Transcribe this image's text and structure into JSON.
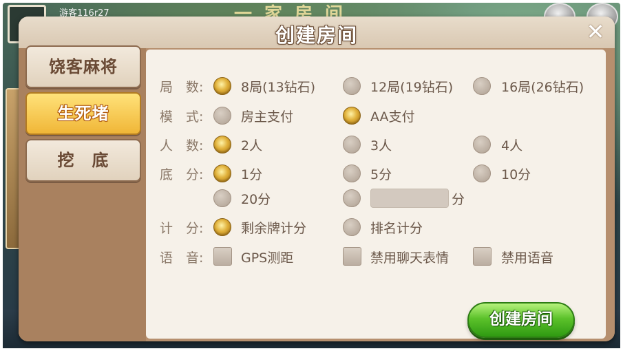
{
  "background": {
    "guest_name": "游客116r27",
    "title_faded": "一家房间"
  },
  "dialog": {
    "title": "创建房间",
    "close_symbol": "✕"
  },
  "tabs": [
    {
      "label": "饶客麻将",
      "active": false
    },
    {
      "label": "生死堵",
      "active": true
    },
    {
      "label": "挖　底",
      "active": false
    }
  ],
  "rows": {
    "rounds": {
      "label": "局　数:",
      "options": [
        "8局(13钻石)",
        "12局(19钻石)",
        "16局(26钻石)"
      ],
      "selected": 0
    },
    "mode": {
      "label": "模　式:",
      "options": [
        "房主支付",
        "AA支付"
      ],
      "selected": 1
    },
    "players": {
      "label": "人　数:",
      "options": [
        "2人",
        "3人",
        "4人"
      ],
      "selected": 0
    },
    "base": {
      "label": "底　分:",
      "options": [
        "1分",
        "5分",
        "10分",
        "20分"
      ],
      "custom_suffix": "分",
      "selected": 0
    },
    "scoring": {
      "label": "计　分:",
      "options": [
        "剩余牌计分",
        "排名计分"
      ],
      "selected": 0
    },
    "voice": {
      "label": "语　音:",
      "options": [
        "GPS测距",
        "禁用聊天表情",
        "禁用语音"
      ],
      "checked": [
        false,
        false,
        false
      ]
    }
  },
  "create_button": "创建房间"
}
